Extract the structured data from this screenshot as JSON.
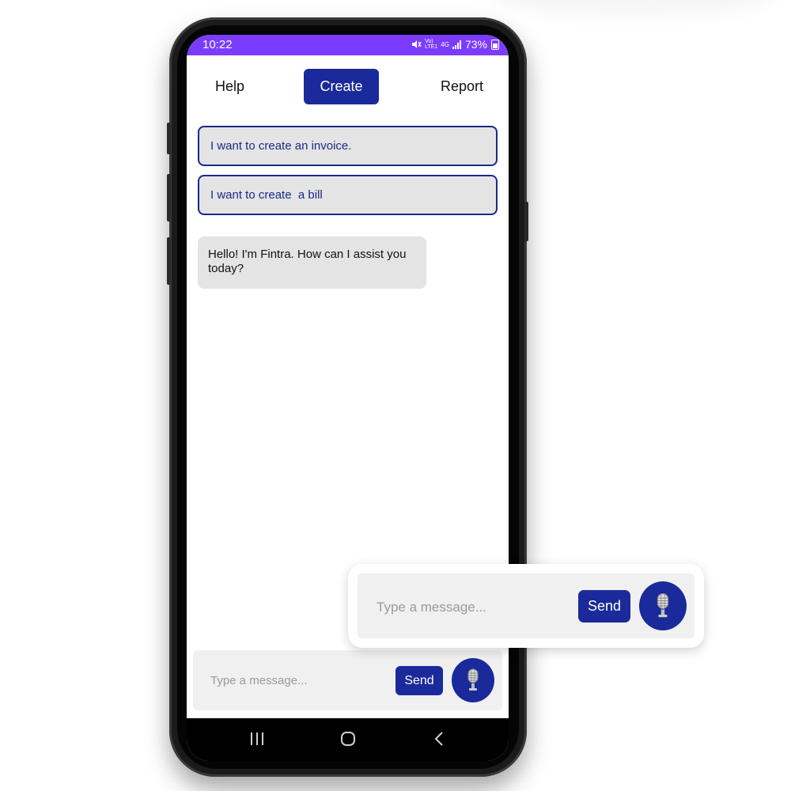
{
  "status_bar": {
    "time": "10:22",
    "network_1": "Vo)",
    "network_2": "LTE1",
    "network_type": "4G",
    "battery": "73%"
  },
  "nav": {
    "help": "Help",
    "create": "Create",
    "report": "Report"
  },
  "suggestions": [
    {
      "label": "I want to create an invoice."
    },
    {
      "label": "I want to create  a bill"
    }
  ],
  "chat": {
    "bot_message": "Hello! I'm Fintra. How can I assist you today?"
  },
  "composer": {
    "placeholder": "Type a message...",
    "send_label": "Send"
  },
  "callout": {
    "placeholder": "Type a message...",
    "send_label": "Send"
  },
  "colors": {
    "status_bar": "#7b3cff",
    "accent": "#1a2a9a",
    "bubble": "#e4e4e4"
  },
  "icons": {
    "mute": "mute-icon",
    "signal": "signal-icon",
    "battery": "battery-icon",
    "mic": "microphone-icon",
    "recent_apps": "recent-apps-icon",
    "home": "home-icon",
    "back": "back-icon"
  }
}
